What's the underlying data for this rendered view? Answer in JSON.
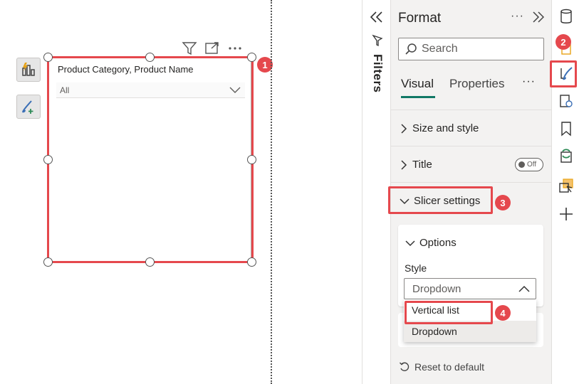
{
  "canvas": {
    "slicer": {
      "title": "Product Category, Product Name",
      "dropdown_value": "All"
    },
    "visual_header_icons": [
      "filter-icon",
      "focus-mode-icon",
      "more-options-icon"
    ],
    "side_tools": [
      "build-visual-icon",
      "format-visual-icon"
    ]
  },
  "filters_pane": {
    "label": "Filters",
    "collapse_icon": "double-chevron-left-icon"
  },
  "format_pane": {
    "title": "Format",
    "more": "···",
    "search_placeholder": "Search",
    "tabs": {
      "visual": "Visual",
      "properties": "Properties",
      "more": "···"
    },
    "sections": {
      "size_and_style": "Size and style",
      "title": "Title",
      "title_toggle": "Off",
      "slicer_settings": "Slicer settings"
    },
    "options": {
      "label": "Options",
      "style_label": "Style",
      "style_value": "Dropdown",
      "style_options": [
        "Vertical list",
        "Dropdown"
      ]
    },
    "reset_label": "Reset to default"
  },
  "callouts": [
    "1",
    "2",
    "3",
    "4"
  ],
  "colors": {
    "highlight": "#e5484d",
    "accent_teal": "#117865",
    "pane_bg": "#f3f2f1"
  }
}
